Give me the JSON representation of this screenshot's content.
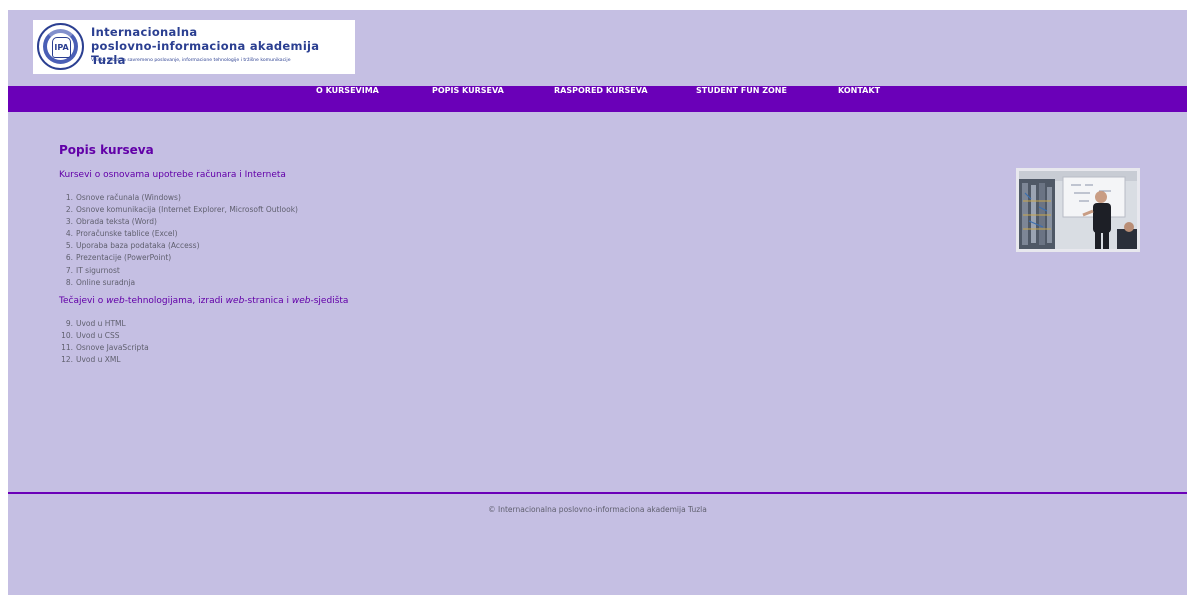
{
  "header": {
    "logo_title_line1": "Internacionalna",
    "logo_title_line2": "poslovno-informaciona akademija Tuzla",
    "logo_subtitle": "Visoka škola za savremeno poslovanje, informacione tehnologije i tržišne komunikacije",
    "logo_mark": "IPA"
  },
  "nav": {
    "items": [
      {
        "label": "O KURSEVIMA"
      },
      {
        "label": "POPIS KURSEVA"
      },
      {
        "label": "RASPORED KURSEVA"
      },
      {
        "label": "STUDENT FUN ZONE"
      },
      {
        "label": "KONTAKT"
      }
    ]
  },
  "main": {
    "title": "Popis kurseva",
    "section1": {
      "heading": "Kursevi o osnovama upotrebe računara i Interneta",
      "items": [
        {
          "num": "1.",
          "label": "Osnove računala (Windows)"
        },
        {
          "num": "2.",
          "label": "Osnove komunikacija (Internet Explorer, Microsoft Outlook)"
        },
        {
          "num": "3.",
          "label": "Obrada teksta (Word)"
        },
        {
          "num": "4.",
          "label": "Proračunske tablice (Excel)"
        },
        {
          "num": "5.",
          "label": "Uporaba baza podataka (Access)"
        },
        {
          "num": "6.",
          "label": "Prezentacije (PowerPoint)"
        },
        {
          "num": "7.",
          "label": "IT sigurnost"
        },
        {
          "num": "8.",
          "label": "Online suradnja"
        }
      ]
    },
    "section2": {
      "heading_part1": "Tečajevi o ",
      "heading_em1": "web",
      "heading_part2": "-tehnologijama, izradi ",
      "heading_em2": "web",
      "heading_part3": "-stranica i ",
      "heading_em3": "web",
      "heading_part4": "-sjedišta",
      "items": [
        {
          "num": "9.",
          "label": "Uvod u HTML"
        },
        {
          "num": "10.",
          "label": "Uvod u CSS"
        },
        {
          "num": "11.",
          "label": "Osnove JavaScripta"
        },
        {
          "num": "12.",
          "label": "Uvod u XML"
        }
      ]
    }
  },
  "footer": {
    "text": "© Internacionalna poslovno-informaciona akademija Tuzla"
  },
  "colors": {
    "page_bg": "#c5bfe3",
    "nav_bg": "#6a00b8",
    "heading": "#6200a8",
    "body_text": "#5f5f6e"
  }
}
